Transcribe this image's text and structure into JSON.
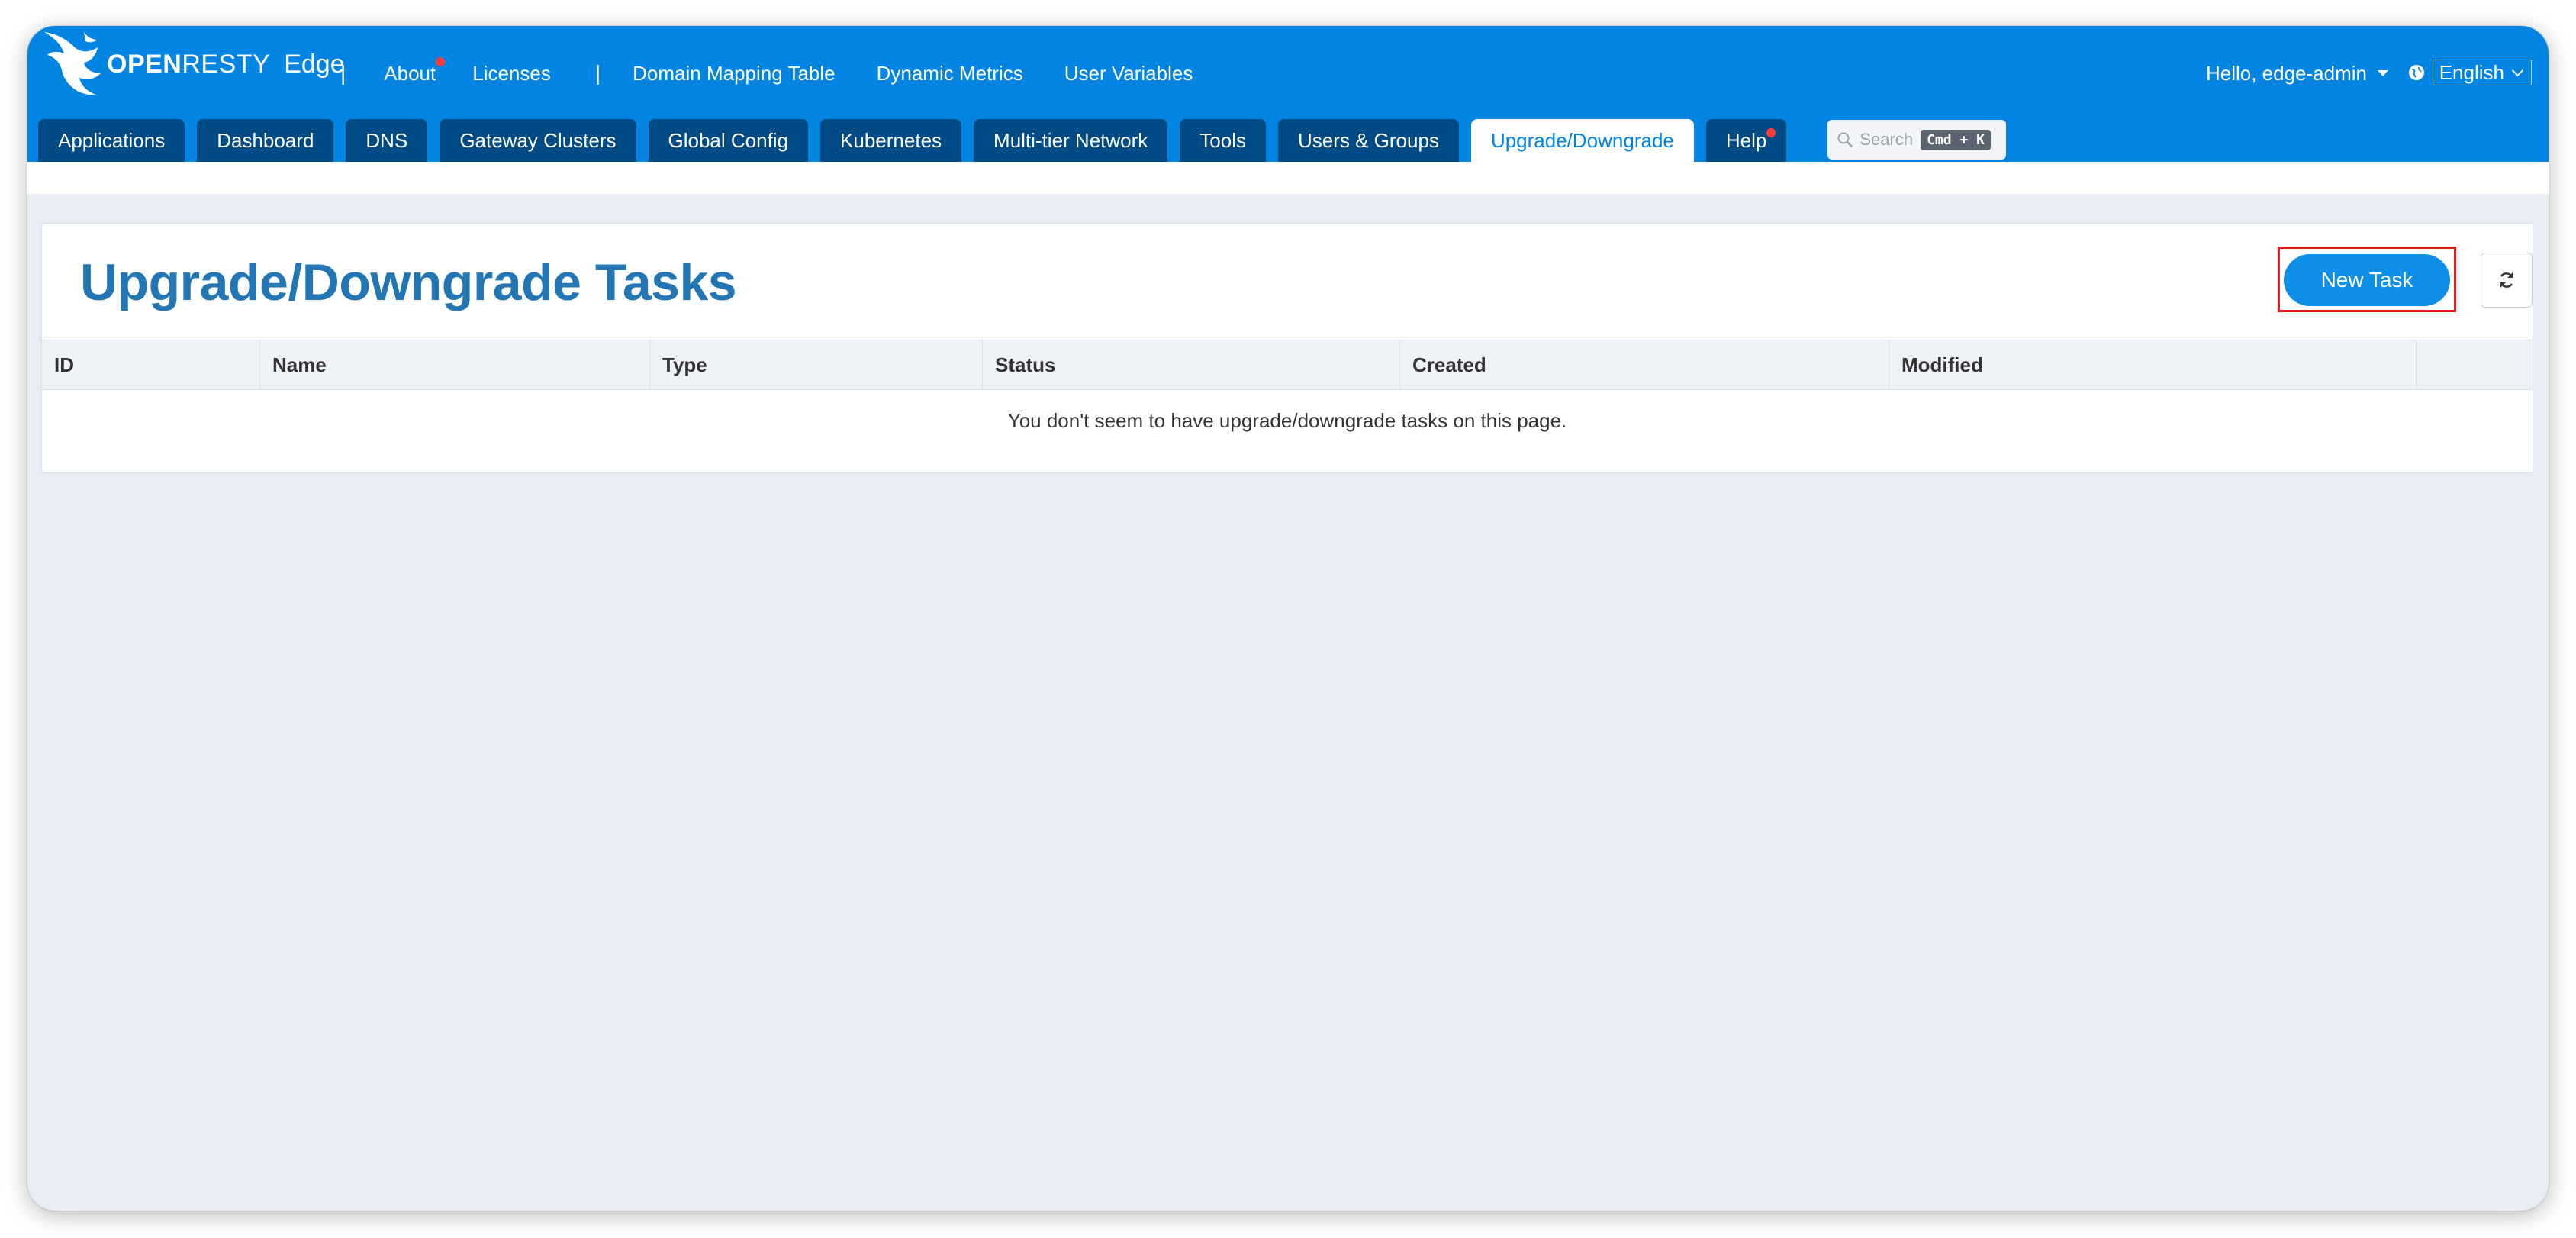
{
  "brand": {
    "logo_open": "OPEN",
    "logo_resty": "RESTY",
    "product": "Edge"
  },
  "topnav": {
    "separator": "|",
    "about": "About",
    "licenses": "Licenses",
    "domain_mapping": "Domain Mapping Table",
    "dynamic_metrics": "Dynamic Metrics",
    "user_variables": "User Variables"
  },
  "user": {
    "greeting": "Hello, edge-admin"
  },
  "language": {
    "selected": "English"
  },
  "tabs": [
    {
      "label": "Applications"
    },
    {
      "label": "Dashboard"
    },
    {
      "label": "DNS"
    },
    {
      "label": "Gateway Clusters"
    },
    {
      "label": "Global Config"
    },
    {
      "label": "Kubernetes"
    },
    {
      "label": "Multi-tier Network"
    },
    {
      "label": "Tools"
    },
    {
      "label": "Users & Groups"
    },
    {
      "label": "Upgrade/Downgrade"
    },
    {
      "label": "Help"
    }
  ],
  "search": {
    "placeholder": "Search",
    "shortcut": "Cmd + K"
  },
  "page": {
    "title": "Upgrade/Downgrade Tasks",
    "new_task_label": "New Task",
    "columns": [
      "ID",
      "Name",
      "Type",
      "Status",
      "Created",
      "Modified",
      ""
    ],
    "empty_message": "You don't seem to have upgrade/downgrade tasks on this page."
  },
  "colors": {
    "brand_blue": "#0284e3",
    "tab_dark": "#004b85",
    "title_blue": "#2276b3",
    "highlight_red": "#e61a1a"
  }
}
